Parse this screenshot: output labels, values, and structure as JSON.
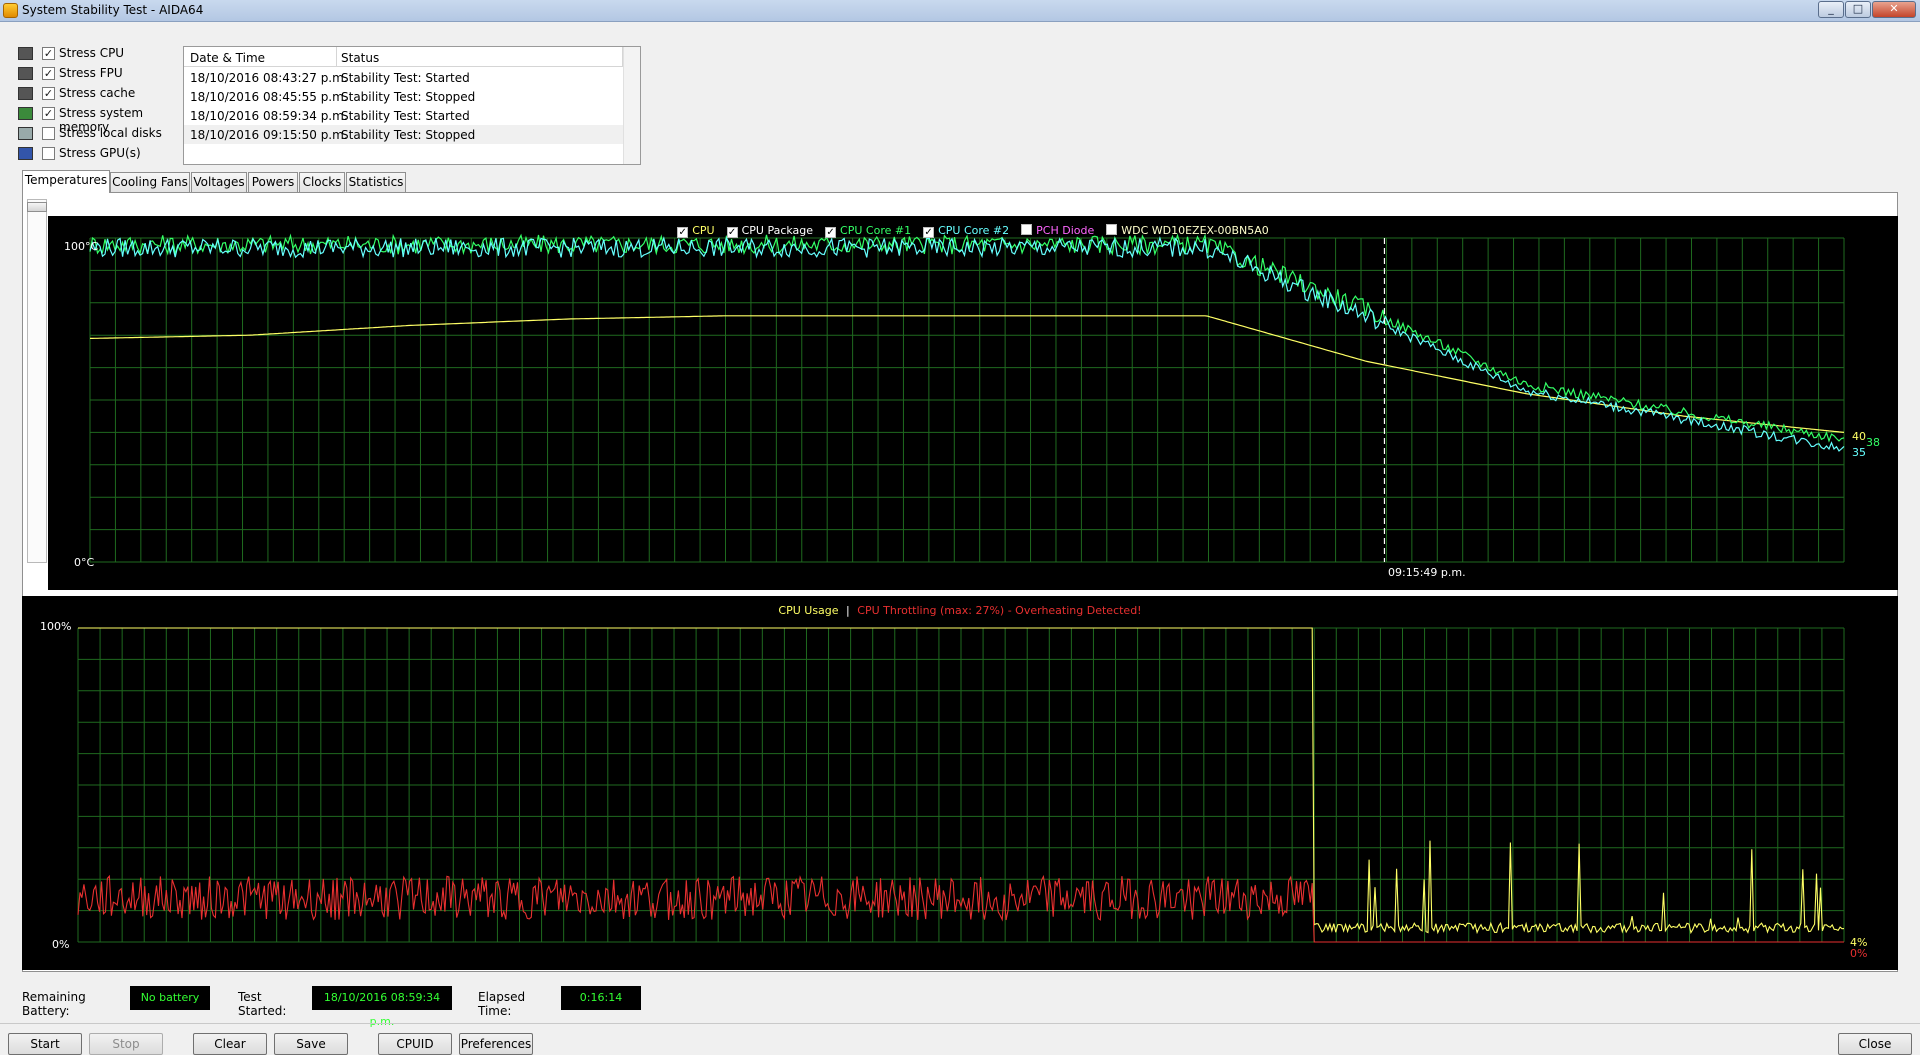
{
  "window": {
    "title": "System Stability Test - AIDA64",
    "min": "_",
    "max": "□",
    "close": "✕"
  },
  "stress": [
    {
      "label": "Stress CPU",
      "checked": true,
      "check": "✓",
      "icon": "cpu-icon"
    },
    {
      "label": "Stress FPU",
      "checked": true,
      "check": "✓",
      "icon": "fpu-icon"
    },
    {
      "label": "Stress cache",
      "checked": true,
      "check": "✓",
      "icon": "cache-icon"
    },
    {
      "label": "Stress system memory",
      "checked": true,
      "check": "✓",
      "icon": "memory-icon"
    },
    {
      "label": "Stress local disks",
      "checked": false,
      "check": "",
      "icon": "disk-icon"
    },
    {
      "label": "Stress GPU(s)",
      "checked": false,
      "check": "",
      "icon": "gpu-icon"
    }
  ],
  "log": {
    "headers": [
      "Date & Time",
      "Status"
    ],
    "rows": [
      {
        "time": "18/10/2016 08:43:27 p.m.",
        "status": "Stability Test: Started"
      },
      {
        "time": "18/10/2016 08:45:55 p.m.",
        "status": "Stability Test: Stopped"
      },
      {
        "time": "18/10/2016 08:59:34 p.m.",
        "status": "Stability Test: Started"
      },
      {
        "time": "18/10/2016 09:15:50 p.m.",
        "status": "Stability Test: Stopped"
      }
    ]
  },
  "tabs": [
    "Temperatures",
    "Cooling Fans",
    "Voltages",
    "Powers",
    "Clocks",
    "Statistics"
  ],
  "temp_chart": {
    "legend": [
      {
        "label": "CPU",
        "checked": true,
        "check": "✓",
        "color": "#ffff66"
      },
      {
        "label": "CPU Package",
        "checked": true,
        "check": "✓",
        "color": "#ffffff"
      },
      {
        "label": "CPU Core #1",
        "checked": true,
        "check": "✓",
        "color": "#33ff66"
      },
      {
        "label": "CPU Core #2",
        "checked": true,
        "check": "✓",
        "color": "#66ffff"
      },
      {
        "label": "PCH Diode",
        "checked": false,
        "check": "",
        "color": "#ff66ff"
      },
      {
        "label": "WDC WD10EZEX-00BN5A0",
        "checked": false,
        "check": "",
        "color": "#ffffcc"
      }
    ],
    "y_max_label": "100°C",
    "y_min_label": "0°C",
    "time_marker": "09:15:49 p.m.",
    "end_values": [
      "40",
      "38",
      "35"
    ],
    "end_colors": [
      "#ffff66",
      "#33ff66",
      "#66ffff"
    ]
  },
  "usage_chart": {
    "legend_usage": "CPU Usage",
    "legend_sep": "|",
    "legend_throttle": "CPU Throttling (max: 27%) - Overheating Detected!",
    "usage_color": "#ffff66",
    "throttle_color": "#e83030",
    "y_max_label": "100%",
    "y_min_label": "0%",
    "end_usage": "4%",
    "end_throttle": "0%"
  },
  "chart_data": [
    {
      "type": "line",
      "title": "",
      "ylim": [
        0,
        100
      ],
      "yunit": "°C",
      "series": [
        {
          "name": "CPU",
          "description": "stair-step rising then cooling",
          "values": [
            69,
            70,
            73,
            75,
            76,
            76,
            76,
            76,
            62,
            52,
            45,
            40
          ]
        },
        {
          "name": "CPU Core #1",
          "values": [
            98,
            98,
            98,
            98,
            98,
            98,
            98,
            98,
            78,
            55,
            46,
            38
          ]
        },
        {
          "name": "CPU Core #2",
          "values": [
            97,
            97,
            97,
            97,
            97,
            97,
            97,
            97,
            76,
            53,
            44,
            35
          ]
        }
      ],
      "marker": "09:15:49 p.m."
    },
    {
      "type": "line",
      "title": "",
      "ylim": [
        0,
        100
      ],
      "yunit": "%",
      "series": [
        {
          "name": "CPU Usage",
          "values": [
            100,
            100,
            100,
            100,
            100,
            100,
            100,
            100,
            2,
            8,
            3,
            4
          ]
        },
        {
          "name": "CPU Throttling",
          "values": [
            12,
            14,
            13,
            15,
            14,
            16,
            14,
            15,
            0,
            0,
            0,
            0
          ]
        }
      ]
    }
  ],
  "status": {
    "battery_label": "Remaining Battery:",
    "battery_value": "No battery",
    "started_label": "Test Started:",
    "started_value": "18/10/2016 08:59:34 p.m.",
    "elapsed_label": "Elapsed Time:",
    "elapsed_value": "0:16:14"
  },
  "buttons": {
    "start": "Start",
    "stop": "Stop",
    "clear": "Clear",
    "save": "Save",
    "cpuid": "CPUID",
    "preferences": "Preferences",
    "close": "Close"
  }
}
